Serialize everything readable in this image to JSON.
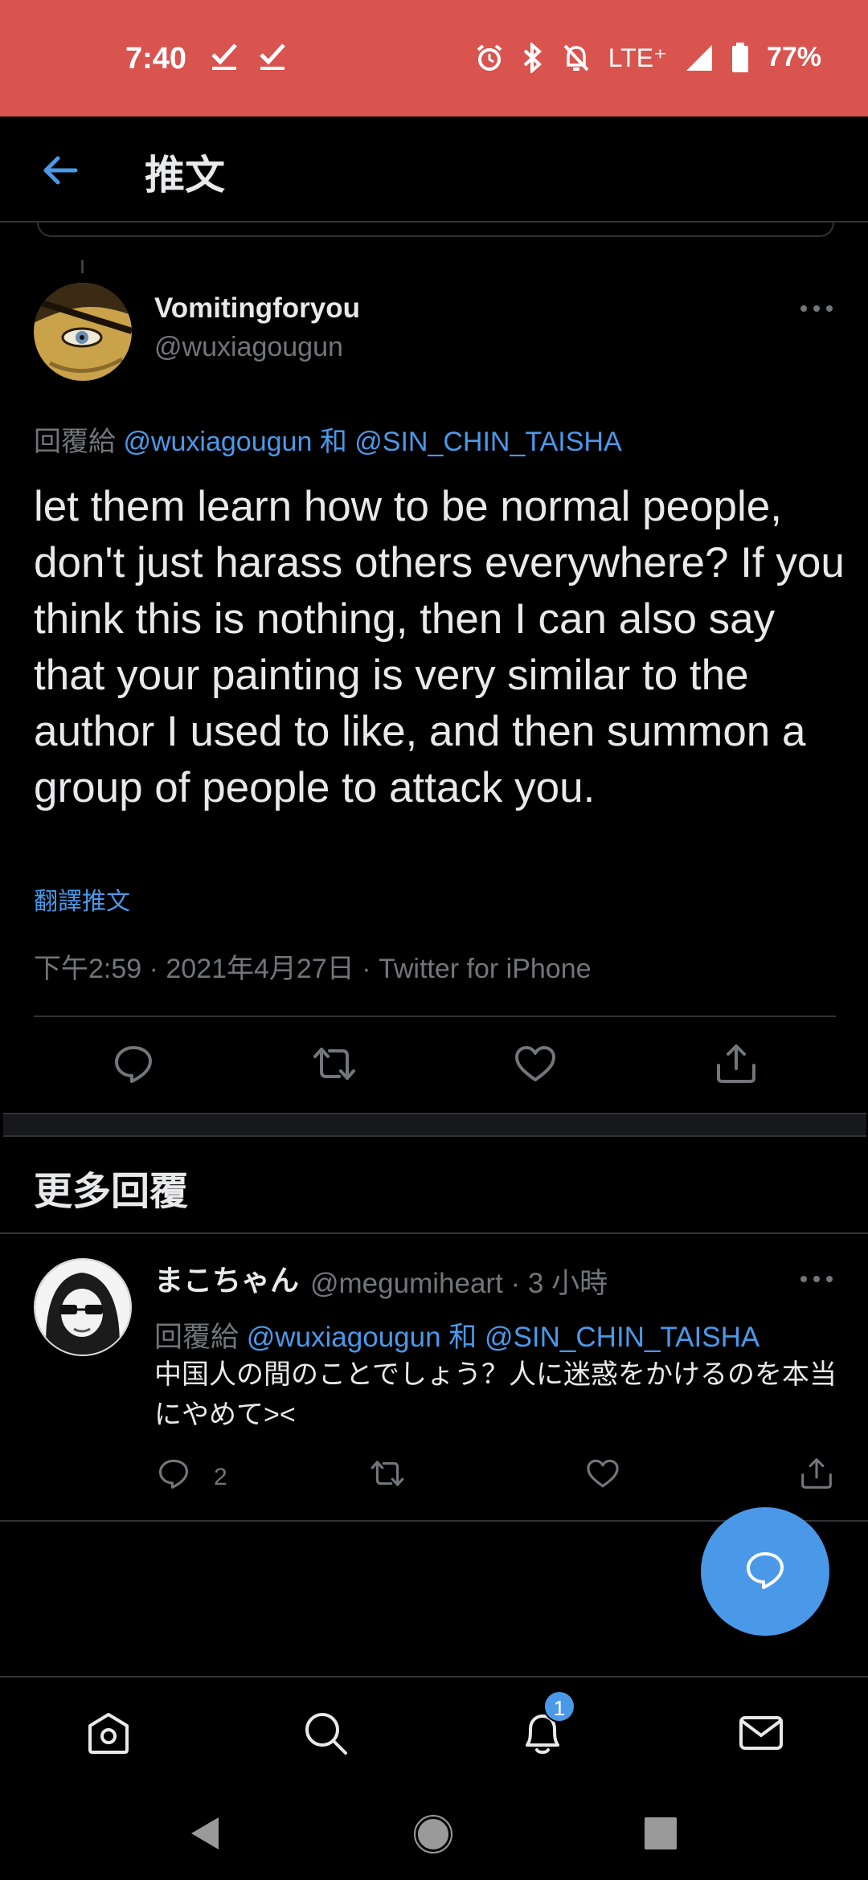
{
  "status_bar": {
    "time": "7:40",
    "network": "LTE⁺",
    "battery": "77%"
  },
  "header": {
    "title": "推文"
  },
  "tweet": {
    "author_name": "Vomitingforyou",
    "author_handle": "@wuxiagougun",
    "reply_prefix": "回覆給",
    "reply_mention_1": "@wuxiagougun",
    "reply_and": "和",
    "reply_mention_2": "@SIN_CHIN_TAISHA",
    "text": "let them learn how to be normal people, don't just harass others everywhere? If you think this is nothing, then I can also say that your painting is very similar to the author I used to like, and then summon a group of people to attack you.",
    "translate_label": "翻譯推文",
    "meta": "下午2:59 · 2021年4月27日 · Twitter for iPhone"
  },
  "more_replies": {
    "title": "更多回覆"
  },
  "reply": {
    "name": "まこちゃん",
    "handle_time": "@megumiheart · 3 小時",
    "reply_prefix": "回覆給",
    "reply_mention_1": "@wuxiagougun",
    "reply_and": "和",
    "reply_mention_2": "@SIN_CHIN_TAISHA",
    "text": "中国人の間のことでしょう？人に迷惑をかけるのを本当にやめて><",
    "reply_count": "2"
  },
  "bottom_nav": {
    "notification_badge": "1"
  },
  "colors": {
    "accent": "#4a99e9",
    "status_bar": "#d9534f",
    "background": "#000000",
    "secondary_text": "#71767b"
  }
}
